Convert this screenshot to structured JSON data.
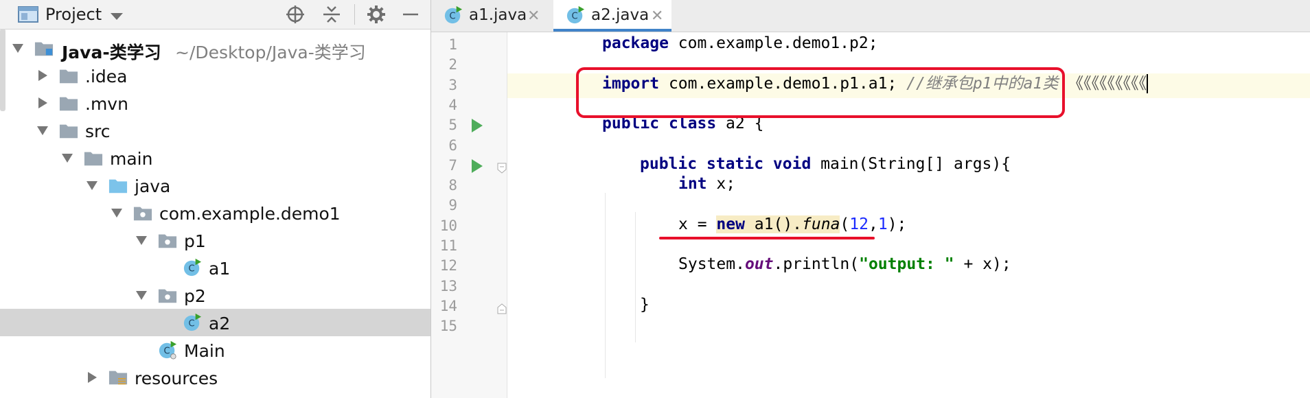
{
  "project_panel": {
    "title": "Project",
    "tree": [
      {
        "label": "Java-类学习",
        "path": "~/Desktop/Java-类学习"
      },
      {
        "label": ".idea"
      },
      {
        "label": ".mvn"
      },
      {
        "label": "src"
      },
      {
        "label": "main"
      },
      {
        "label": "java"
      },
      {
        "label": "com.example.demo1"
      },
      {
        "label": "p1"
      },
      {
        "label": "a1"
      },
      {
        "label": "p2"
      },
      {
        "label": "a2"
      },
      {
        "label": "Main"
      },
      {
        "label": "resources"
      }
    ]
  },
  "tabs": [
    {
      "label": "a1.java",
      "active": false
    },
    {
      "label": "a2.java",
      "active": true
    }
  ],
  "editor": {
    "line_numbers": [
      "1",
      "2",
      "3",
      "4",
      "5",
      "6",
      "7",
      "8",
      "9",
      "10",
      "11",
      "12",
      "13",
      "14",
      "15"
    ],
    "current_line": 3,
    "code": {
      "l1_kw": "package",
      "l1_rest": " com.example.demo1.p2;",
      "l3_kw": "import",
      "l3_rest": " com.example.demo1.p1.a1; ",
      "l3_cmt_a": "//继承包",
      "l3_cmt_b": "p1",
      "l3_cmt_c": "中的",
      "l3_cmt_d": "a1",
      "l3_cmt_e": "类",
      "l3_marks": " 《《《《《《《《《",
      "l5_kw1": "public",
      "l5_kw2": "class",
      "l5_rest": " a2 {",
      "l7_kw1": "public",
      "l7_kw2": "static",
      "l7_kw3": "void",
      "l7_rest": " main(String[] args){",
      "l8_kw": "int",
      "l8_rest": " x;",
      "l10_a": "x = ",
      "l10_kw": "new",
      "l10_b": " a1().",
      "l10_fn": "funa",
      "l10_c": "(",
      "l10_n1": "12",
      "l10_d": ",",
      "l10_n2": "1",
      "l10_e": ");",
      "l12_a": "System.",
      "l12_field": "out",
      "l12_b": ".println(",
      "l12_str": "\"output: \"",
      "l12_c": " + x);",
      "l14": "}"
    }
  },
  "colors": {
    "annotation": "#e8102b",
    "keyword": "#000080",
    "string": "#008000",
    "number": "#1a2aff",
    "comment": "#808080",
    "tab_underline": "#4083c9"
  },
  "icons": [
    "project-view-icon",
    "dropdown-icon",
    "locate-icon",
    "collapse-all-icon",
    "gear-icon",
    "minimize-icon",
    "folder-icon",
    "package-icon",
    "java-class-icon",
    "run-gutter-icon",
    "fold-icon"
  ]
}
